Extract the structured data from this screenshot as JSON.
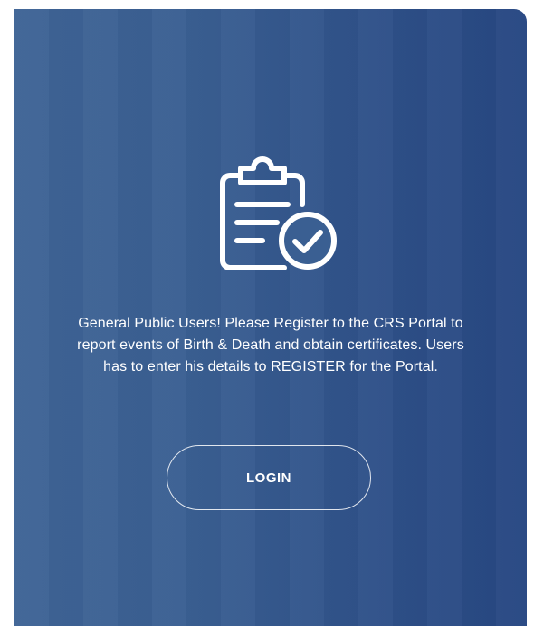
{
  "card": {
    "icon": "clipboard-check-icon",
    "message": "General Public Users! Please Register to the CRS Portal to report events of Birth & Death and obtain certificates. Users has to enter his details to REGISTER for the Portal.",
    "login_label": "LOGIN"
  },
  "colors": {
    "card_bg_start": "#3f6496",
    "card_bg_end": "#274782",
    "text": "#ffffff"
  }
}
